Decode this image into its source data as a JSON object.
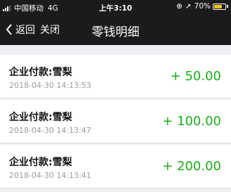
{
  "status_bar": {
    "carrier": "中国移动",
    "network": "4G",
    "time": "上午3:10",
    "battery_percent": "70%",
    "battery_level": 0.7,
    "battery_color": "#f5c518"
  },
  "nav": {
    "back_label": "返回",
    "close_label": "关闭",
    "title": "零钱明细"
  },
  "transactions": [
    {
      "title": "企业付款:雪梨",
      "timestamp": "2018-04-30 14:13:53",
      "amount": "+ 50.00"
    },
    {
      "title": "企业付款:雪梨",
      "timestamp": "2018-04-30 14:13:47",
      "amount": "+ 100.00"
    },
    {
      "title": "企业付款:雪梨",
      "timestamp": "2018-04-30 14:13:41",
      "amount": "+ 200.00"
    }
  ],
  "colors": {
    "amount_green": "#1aad19",
    "header_bg": "#1b1b1d"
  }
}
